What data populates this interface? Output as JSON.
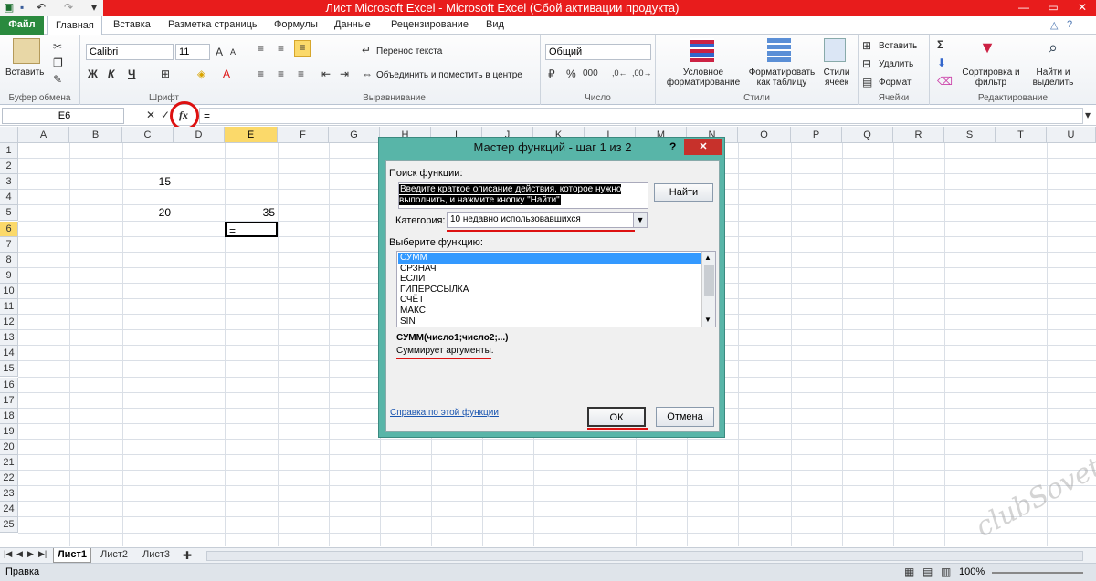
{
  "window": {
    "title": "Лист Microsoft Excel - Microsoft Excel (Сбой активации продукта)"
  },
  "tabs": [
    "Файл",
    "Главная",
    "Вставка",
    "Разметка страницы",
    "Формулы",
    "Данные",
    "Рецензирование",
    "Вид"
  ],
  "ribbon": {
    "clipboard": {
      "paste": "Вставить",
      "label": "Буфер обмена"
    },
    "font": {
      "name": "Calibri",
      "size": "11",
      "bold": "Ж",
      "italic": "К",
      "underline": "Ч",
      "label": "Шрифт"
    },
    "alignment": {
      "wrap": "Перенос текста",
      "merge": "Объединить и поместить в центре",
      "label": "Выравнивание"
    },
    "number": {
      "format": "Общий",
      "percent": "%",
      "thousands": "000",
      "label": "Число"
    },
    "styles": {
      "conditional": "Условное форматирование",
      "as_table": "Форматировать как таблицу",
      "cell_styles": "Стили ячеек",
      "label": "Стили"
    },
    "cells": {
      "insert": "Вставить",
      "delete": "Удалить",
      "format": "Формат",
      "label": "Ячейки"
    },
    "editing": {
      "sort": "Сортировка и фильтр",
      "find": "Найти и выделить",
      "label": "Редактирование"
    }
  },
  "formula_bar": {
    "name_box": "E6",
    "fx": "fx",
    "content": "="
  },
  "columns": [
    "A",
    "B",
    "C",
    "D",
    "E",
    "F",
    "G",
    "H",
    "I",
    "J",
    "K",
    "L",
    "M",
    "N",
    "O",
    "P",
    "Q",
    "R",
    "S",
    "T",
    "U"
  ],
  "rows": [
    "1",
    "2",
    "3",
    "4",
    "5",
    "6",
    "7",
    "8",
    "9",
    "10",
    "11",
    "12",
    "13",
    "14",
    "15",
    "16",
    "17",
    "18",
    "19",
    "20",
    "21",
    "22",
    "23",
    "24",
    "25"
  ],
  "cells": {
    "C3": "15",
    "C5": "20",
    "E5": "35",
    "E6": "="
  },
  "sheets": [
    "Лист1",
    "Лист2",
    "Лист3"
  ],
  "status": {
    "mode": "Правка",
    "zoom": "100%"
  },
  "dialog": {
    "title": "Мастер функций - шаг 1 из 2",
    "search_label": "Поиск функции:",
    "search_value": "Введите краткое описание действия, которое нужно выполнить, и нажмите кнопку \"Найти\"",
    "find_button": "Найти",
    "category_label": "Категория:",
    "category_value": "10 недавно использовавшихся",
    "choose_label": "Выберите функцию:",
    "functions": [
      "СУММ",
      "СРЗНАЧ",
      "ЕСЛИ",
      "ГИПЕРССЫЛКА",
      "СЧЁТ",
      "МАКС",
      "SIN"
    ],
    "signature": "СУММ(число1;число2;...)",
    "description": "Суммирует аргументы.",
    "help_link": "Справка по этой функции",
    "ok": "ОК",
    "cancel": "Отмена"
  },
  "watermark": "clubSovet",
  "colors": {
    "accent_red": "#d11111",
    "file_tab": "#2a8a3e",
    "dialog_frame": "#58b5a8",
    "selection": "#3399ff"
  }
}
